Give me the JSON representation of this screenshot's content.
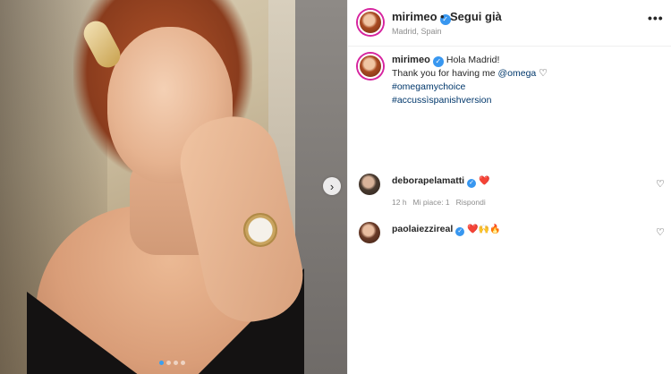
{
  "post": {
    "author": "mirimeo",
    "follow_separator": "•",
    "follow_label": "Segui già",
    "location": "Madrid, Spain",
    "more_icon": "•••",
    "carousel": {
      "slides": 4,
      "active_index": 0,
      "next_icon": "›"
    }
  },
  "caption": {
    "author": "mirimeo",
    "line1": "Hola Madrid!",
    "line2_prefix": "Thank you for having me",
    "mention": "@omega",
    "heart": "♡",
    "hashtags": [
      "#omegamychoice",
      "#accussìspanishversion"
    ]
  },
  "comments": [
    {
      "username": "deborapelamatti",
      "emoji": "❤️",
      "time": "12 h",
      "likes": "Mi piace: 1",
      "reply": "Rispondi",
      "like_icon": "♡"
    },
    {
      "username": "paolaiezzireal",
      "emoji": "❤️🙌🔥",
      "like_icon": "♡"
    }
  ],
  "icons": {
    "verified": "✓"
  }
}
